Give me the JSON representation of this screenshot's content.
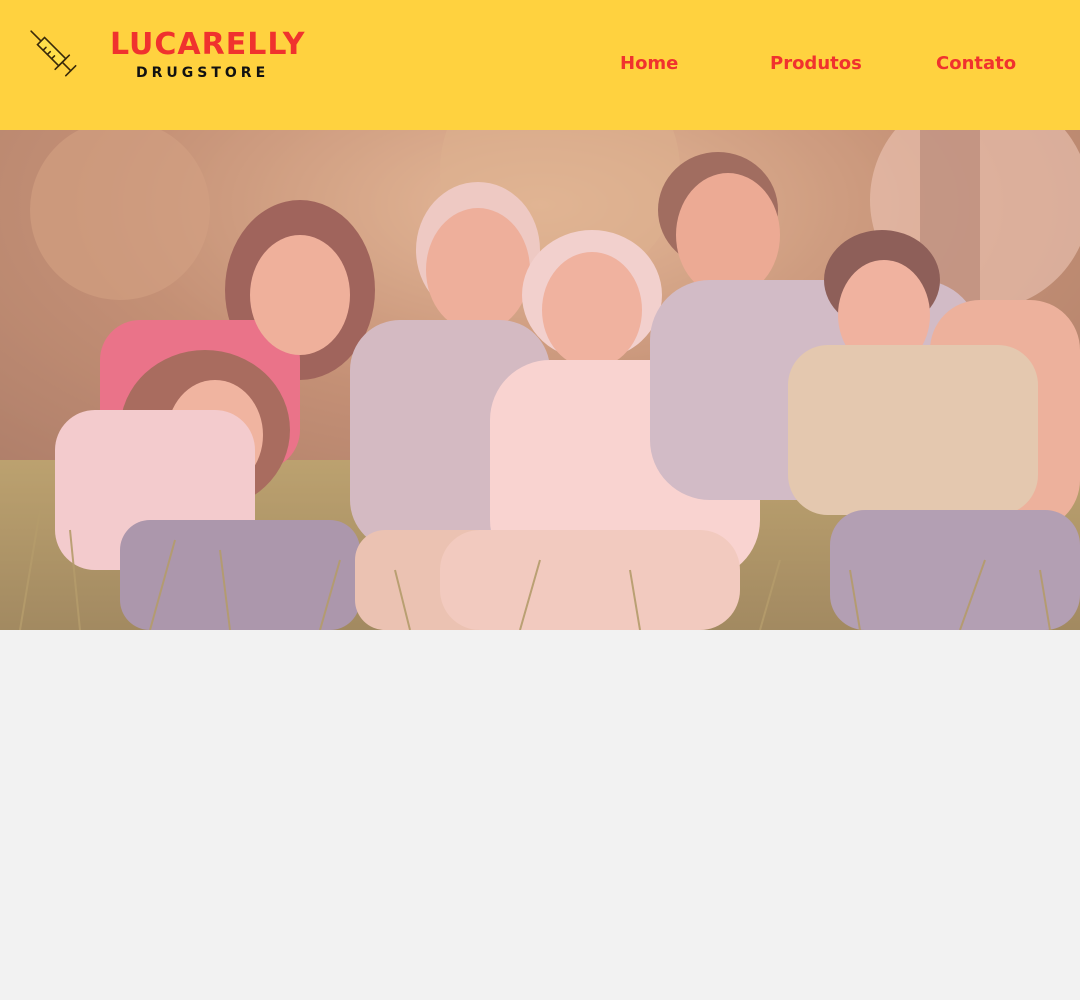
{
  "brand": {
    "name": "LUCARELLY",
    "subtitle": "DRUGSTORE",
    "logo_icon": "syringe-icon"
  },
  "nav": {
    "items": [
      {
        "label": "Home"
      },
      {
        "label": "Produtos"
      },
      {
        "label": "Contato"
      }
    ]
  },
  "hero": {
    "image_subject": "family-photo"
  },
  "colors": {
    "header_bg": "#ffd23f",
    "accent_red": "#f0322e",
    "page_bg": "#f2f2f2",
    "overlay_pink": "#f6aaaa"
  }
}
